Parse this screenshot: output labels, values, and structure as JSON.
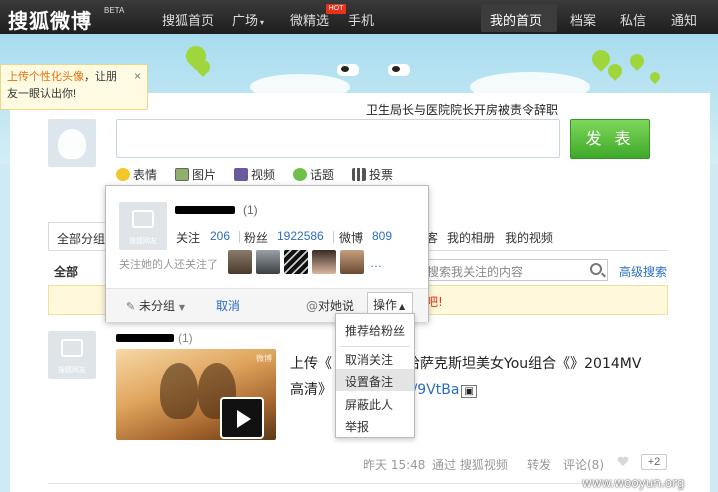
{
  "topnav": {
    "logo": "搜狐微博",
    "beta": "BETA",
    "items": [
      "搜狐首页",
      "广场",
      "微精选",
      "手机"
    ],
    "hot": "HOT",
    "right_items": [
      "我的首页",
      "档案",
      "私信",
      "通知"
    ]
  },
  "tip": {
    "highlight": "上传个性化头像",
    "rest_line1": "，让朋",
    "line2": "友一眼认出你!",
    "close": "×"
  },
  "composer": {
    "headline": "卫生局长与医院院长开房被责令辞职",
    "publish": "发 表",
    "tools": [
      "表情",
      "图片",
      "视频",
      "话题",
      "投票"
    ]
  },
  "tabs": {
    "all_groups": "全部分组",
    "clipped_left": "▾",
    "items": [
      "客",
      "我的相册",
      "我的视频"
    ]
  },
  "filter": {
    "all": "全部",
    "search_placeholder": "搜索我关注的内容",
    "advanced": "高级搜索",
    "notice": "吧!"
  },
  "card": {
    "count": "(1)",
    "stats": [
      {
        "label": "关注",
        "value": "206"
      },
      {
        "label": "粉丝",
        "value": "1922586"
      },
      {
        "label": "微博",
        "value": "809"
      }
    ],
    "common": "关注她的人还关注了",
    "more": "…",
    "avatar_label": "搜狐网友",
    "ungroup": "未分组",
    "cancel": "取消",
    "say": "对她说",
    "ops": "操作"
  },
  "menu": {
    "items": [
      "推荐给粉丝",
      "取消关注",
      "设置备注",
      "屏蔽此人",
      "举报"
    ],
    "active": "设置备注"
  },
  "feed": {
    "count": "(1)",
    "avatar_label": "搜狐网友",
    "text_line1": "上传《",
    "text_line1b": "！哈萨克斯坦美女You组合《》2014MV",
    "text_line2": "高清》",
    "link": "cn/9VtBa",
    "thumb_badge": "微博",
    "meta": {
      "time": "昨天 15:48",
      "source": "通过 搜狐视频",
      "repost": "转发",
      "comment": "评论(8)",
      "plus": "+2"
    }
  },
  "watermark": "www.wooyun.org",
  "colors": {
    "topbar": "#252525",
    "link": "#2a6ec4",
    "publish": "#4cb534",
    "notice": "#e8340c",
    "highlight": "#e8700a"
  }
}
